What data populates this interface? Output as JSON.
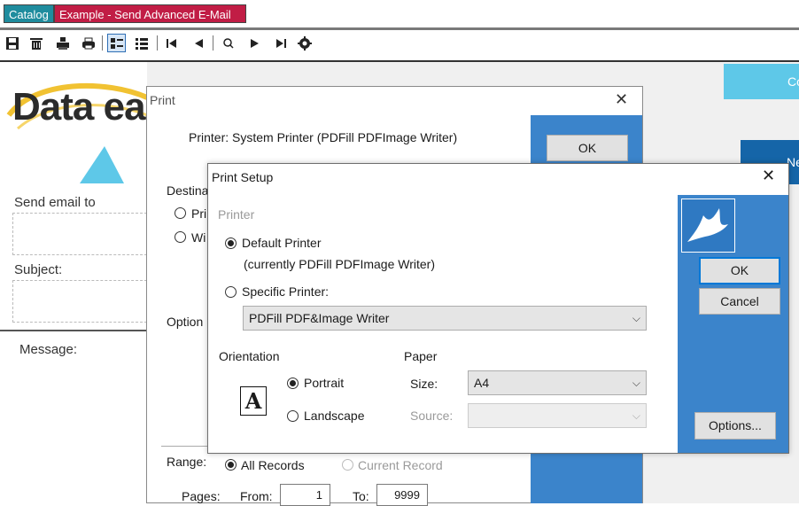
{
  "tabs": {
    "catalog": "Catalog",
    "example": "Example - Send Advanced E-Mail"
  },
  "toolbar": [
    "save-icon",
    "delete-icon",
    "print-preview-icon",
    "printer-icon",
    "details-icon",
    "list-icon",
    "first-page-icon",
    "prev-page-icon",
    "zoom-icon",
    "next-page-icon",
    "last-page-icon",
    "settings-icon"
  ],
  "form": {
    "logo": "Data ea",
    "send_email_label": "Send email to",
    "subject_label": "Subject:",
    "message_label": "Message:",
    "top_right_button": "Co",
    "right_blue_button": "Ne"
  },
  "print_dialog": {
    "title": "Print",
    "ok": "OK",
    "printer_line": "Printer:  System Printer (PDFill PDFImage Writer)",
    "destination_label": "Destina",
    "dest_option1": "Pri",
    "dest_option2": "Wi",
    "options_label": "Option",
    "range_label": "Range:",
    "all_records": "All Records",
    "current_record": "Current Record",
    "pages_label": "Pages:",
    "from_label": "From:",
    "from_value": "1",
    "to_label": "To:",
    "to_value": "9999"
  },
  "setup_dialog": {
    "title": "Print Setup",
    "printer_group": "Printer",
    "default_printer": "Default Printer",
    "currently": "(currently PDFill PDFImage Writer)",
    "specific_printer": "Specific Printer:",
    "printer_select": "PDFill PDF&Image Writer",
    "orientation_group": "Orientation",
    "portrait": "Portrait",
    "landscape": "Landscape",
    "paper_group": "Paper",
    "size_label": "Size:",
    "size_value": "A4",
    "source_label": "Source:",
    "source_value": "",
    "ok": "OK",
    "cancel": "Cancel",
    "options": "Options...",
    "doc_letter": "A"
  }
}
